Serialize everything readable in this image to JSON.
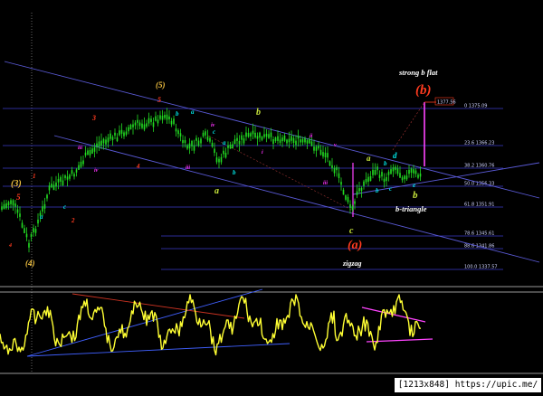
{
  "chart_data": {
    "type": "line",
    "title": "",
    "panels": [
      "price",
      "oscillator"
    ],
    "fib_levels": [
      {
        "label": "0  1375.09"
      },
      {
        "label": "23.6  1366.23"
      },
      {
        "label": "38.2  1360.76"
      },
      {
        "label": "50.0  1356.33"
      },
      {
        "label": "61.8  1351.91"
      },
      {
        "label": "78.6  1345.61"
      },
      {
        "label": "88.6  1341.86"
      },
      {
        "label": "100.0  1337.57"
      }
    ],
    "target_price": "1377.56",
    "wave_labels": {
      "w3": "(3)",
      "w4": "(4)",
      "w5": "(5)",
      "wa": "(a)",
      "wb": "(b)",
      "sub_a": "a",
      "sub_b": "b",
      "sub_c": "c",
      "sub_d": "d",
      "sub_e": "e",
      "sub_b2": "b",
      "sub_a2": "a",
      "sub_b3": "b",
      "r1": "1",
      "r2": "2",
      "r3": "3",
      "r4": "4",
      "r5": "5",
      "m_a": "a",
      "m_b": "b",
      "m_c": "c",
      "m_i": "i",
      "m_ii": "ii",
      "m_iii": "iii",
      "m_iv": "iv",
      "m_v": "v"
    },
    "annotations": {
      "strong_b_flat": "strong b flat",
      "b_triangle": "b-triangle",
      "zigzag": "zigzag"
    },
    "colors": {
      "background": "#000000",
      "price": "#22dd22",
      "channel": "#5a5ad6",
      "fib": "#3a3ac8",
      "target": "#ff44ff",
      "osc": "#ffff33",
      "osc_trend_red": "#cc3322",
      "osc_trend_blue": "#4060ff",
      "osc_triangle": "#ff44ff",
      "label_orange": "#ff8c1a",
      "label_red": "#ff3b1f",
      "label_yellow_green": "#c8e63c",
      "label_cyan": "#00e5e5",
      "label_magenta": "#ff33ff",
      "label_gold": "#f0c040"
    },
    "grid": false,
    "legend": "none"
  },
  "footer": {
    "text": "[1213x848] https://upic.me/"
  }
}
